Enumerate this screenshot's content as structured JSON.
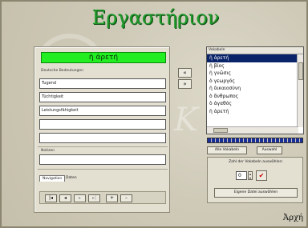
{
  "title": "Εργαστήριον",
  "form": {
    "greenbar_text": "ἡ ἀρετή",
    "section_label": "Deutsche Bedeutungen",
    "fields": [
      "Tugend",
      "Tüchtigkeit",
      "Leistungsfähigkeit",
      "",
      ""
    ],
    "notes_label": "Notizen",
    "tabs": [
      "Navigation",
      "Daten"
    ],
    "nav_buttons": [
      "|◂",
      "◂",
      "▸",
      "▸|",
      "+",
      "–"
    ]
  },
  "arrows": [
    "«",
    "»"
  ],
  "list": {
    "header": "Vokabeln",
    "items": [
      "ἡ ἀρετή",
      "ἡ βίος",
      "ἡ γνῶσις",
      "ὁ γεωργός",
      "ἡ δικαιοσύνη",
      "ὁ ἄνθρωπος",
      "ὁ ἀγαθός",
      "ἡ ἀρετή"
    ],
    "selected_index": 0
  },
  "progress_fraction": 1.0,
  "buttons": {
    "left_small": "Alle Vokabeln",
    "right_small": "Auswahl",
    "choose_text": "Zahl der Vokabeln auswählen:",
    "count_value": "0",
    "ok_symbol": "✔",
    "big_button": "Eigene Datei auswählen"
  },
  "back_label": "Ἀρχή"
}
